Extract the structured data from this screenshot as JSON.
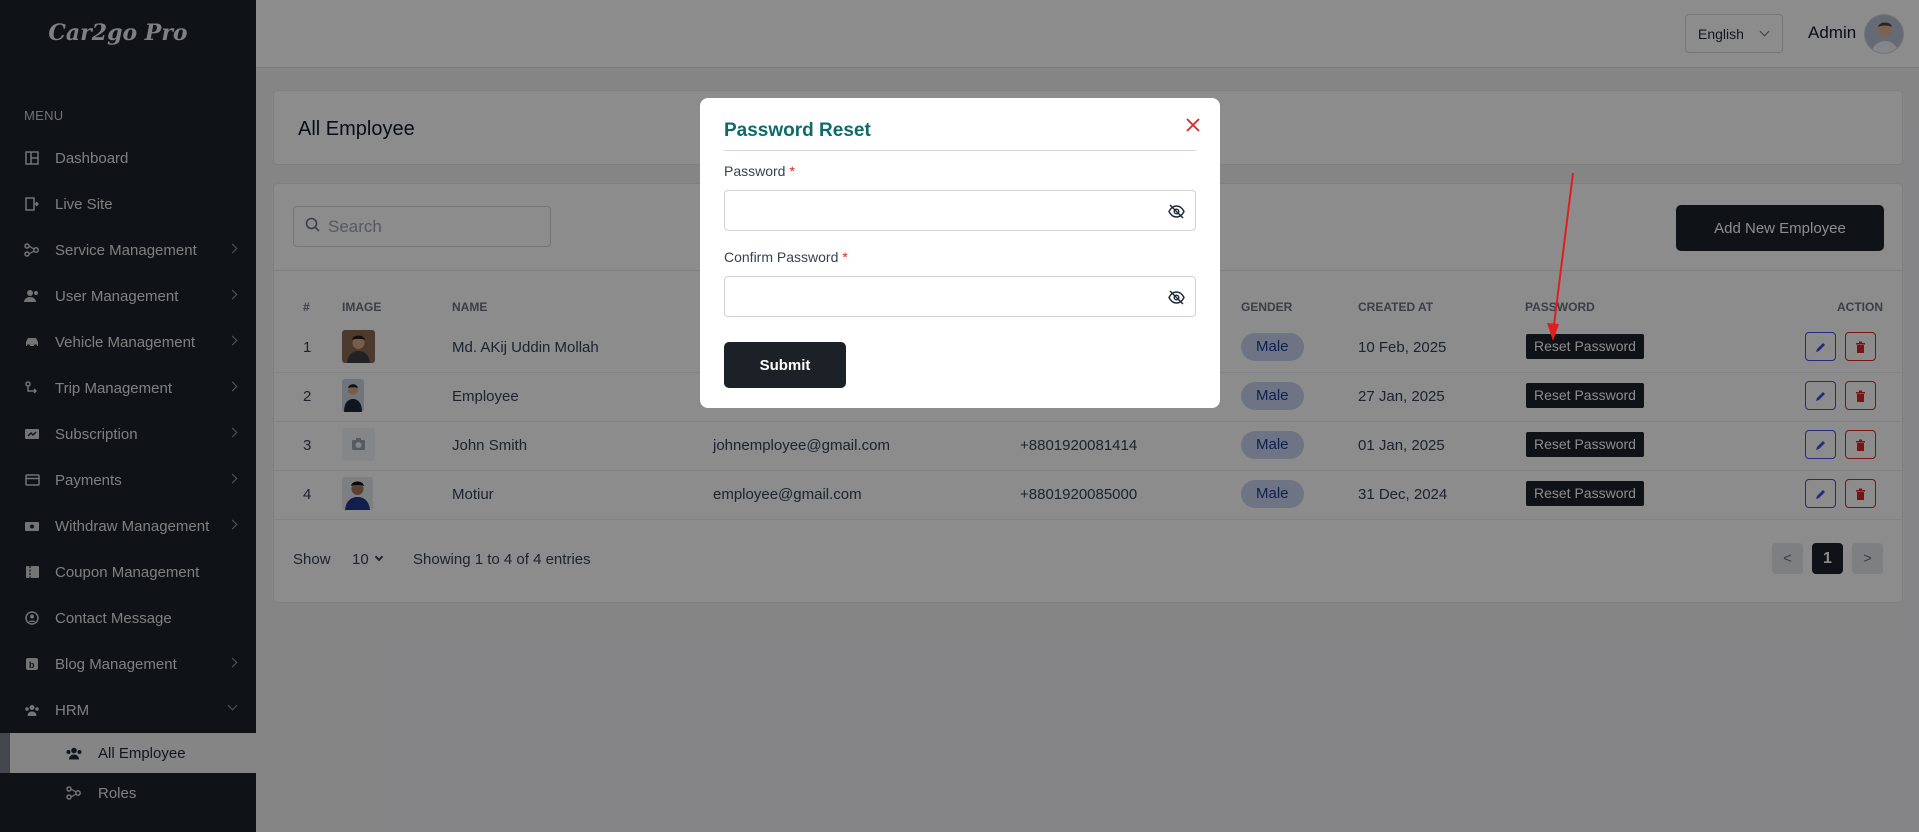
{
  "app": {
    "logo": "Car2go Pro"
  },
  "sidebar": {
    "menu_heading": "MENU",
    "items": [
      {
        "label": "Dashboard",
        "icon": "dashboard-icon",
        "has_children": false
      },
      {
        "label": "Live Site",
        "icon": "external-site-icon",
        "has_children": false
      },
      {
        "label": "Service Management",
        "icon": "services-icon",
        "has_children": true
      },
      {
        "label": "User Management",
        "icon": "users-icon",
        "has_children": true
      },
      {
        "label": "Vehicle Management",
        "icon": "car-icon",
        "has_children": true
      },
      {
        "label": "Trip Management",
        "icon": "trip-icon",
        "has_children": true
      },
      {
        "label": "Subscription",
        "icon": "subscription-icon",
        "has_children": true
      },
      {
        "label": "Payments",
        "icon": "payment-card-icon",
        "has_children": true
      },
      {
        "label": "Withdraw Management",
        "icon": "withdraw-icon",
        "has_children": true
      },
      {
        "label": "Coupon Management",
        "icon": "coupon-icon",
        "has_children": false
      },
      {
        "label": "Contact Message",
        "icon": "contact-icon",
        "has_children": false
      },
      {
        "label": "Blog Management",
        "icon": "blog-icon",
        "has_children": true
      },
      {
        "label": "HRM",
        "icon": "hrm-icon",
        "has_children": true,
        "expanded": true
      }
    ],
    "sub_items": [
      {
        "label": "All Employee",
        "icon": "employees-icon",
        "active": true
      },
      {
        "label": "Roles",
        "icon": "roles-icon",
        "active": false
      }
    ]
  },
  "topbar": {
    "language": "English",
    "admin_name": "Admin"
  },
  "page": {
    "title": "All Employee",
    "search_placeholder": "Search",
    "add_button": "Add New Employee"
  },
  "table": {
    "headers": [
      "#",
      "IMAGE",
      "NAME",
      "GENDER",
      "CREATED AT",
      "PASSWORD",
      "ACTION"
    ],
    "rows": [
      {
        "index": "1",
        "name": "Md. AKij Uddin Mollah",
        "email": "",
        "phone": "",
        "gender": "Male",
        "created_at": "10 Feb, 2025",
        "reset_label": "Reset Password"
      },
      {
        "index": "2",
        "name": "Employee",
        "email": "",
        "phone": "",
        "gender": "Male",
        "created_at": "27 Jan, 2025",
        "reset_label": "Reset Password"
      },
      {
        "index": "3",
        "name": "John Smith",
        "email": "johnemployee@gmail.com",
        "phone": "+8801920081414",
        "gender": "Male",
        "created_at": "01 Jan, 2025",
        "reset_label": "Reset Password"
      },
      {
        "index": "4",
        "name": "Motiur",
        "email": "employee@gmail.com",
        "phone": "+8801920085000",
        "gender": "Male",
        "created_at": "31 Dec, 2024",
        "reset_label": "Reset Password"
      }
    ]
  },
  "pagination": {
    "show_label": "Show",
    "page_size": "10",
    "info": "Showing 1 to 4 of 4 entries",
    "prev": "<",
    "current": "1",
    "next": ">"
  },
  "modal": {
    "title": "Password Reset",
    "password_label": "Password",
    "confirm_label": "Confirm Password",
    "required_mark": "*",
    "password_value": "",
    "confirm_value": "",
    "submit": "Submit"
  },
  "colors": {
    "sidebar_bg": "#1c2128",
    "modal_title": "#0f6b6b",
    "required": "#dc2626",
    "badge_bg": "#c9d4ef",
    "annotation_arrow": "#e11d1d"
  }
}
